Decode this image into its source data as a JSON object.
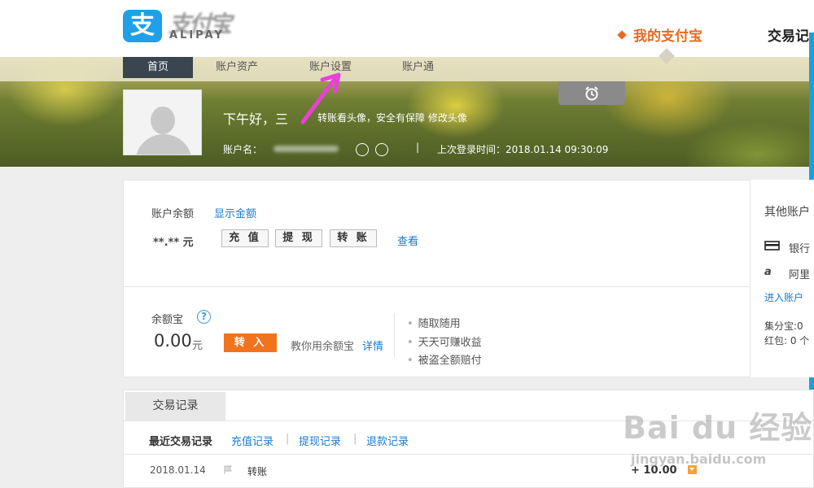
{
  "header": {
    "logo_glyph": "支",
    "logo_cn": "支付宝",
    "logo_en": "ALIPAY",
    "nav_mine": "我的支付宝",
    "nav_trade": "交易记"
  },
  "subnav": {
    "items": [
      "首页",
      "账户资产",
      "账户设置",
      "账户通"
    ],
    "active": "首页"
  },
  "profile": {
    "greeting": "下午好，三",
    "avatar_tip": "转账看头像，安全有保障 修改头像",
    "account_label": "账户名：",
    "last_login_label": "上次登录时间：",
    "last_login_value": "2018.01.14 09:30:09",
    "separator": "|"
  },
  "balance": {
    "label": "账户余额",
    "show_link": "显示金额",
    "amount_masked": "**.** 元",
    "buttons": [
      "充 值",
      "提 现",
      "转 账"
    ],
    "view_link": "查看"
  },
  "yuebao": {
    "title": "余额宝",
    "help": "?",
    "amount": "0.00",
    "unit": "元",
    "transfer_in": "转 入",
    "teach": "教你用余额宝",
    "detail_link": "详情",
    "features": [
      "随取随用",
      "天天可赚收益",
      "被盗全额赔付"
    ]
  },
  "side": {
    "title": "其他账户",
    "bank": "银行",
    "ali": "阿里",
    "enter": "进入账户",
    "jifen": "集分宝:0",
    "hongbao": "红包: 0 个"
  },
  "transactions": {
    "tab": "交易记录",
    "recent_label": "最近交易记录",
    "links": [
      "充值记录",
      "提现记录",
      "退款记录"
    ],
    "pipe": "|",
    "rows": [
      {
        "date": "2018.01.14",
        "type": "转账",
        "amount": "+ 10.00"
      }
    ]
  },
  "watermark": {
    "main": "Bai du 经验",
    "sub": "jingyan.baidu.com"
  },
  "colors": {
    "accent": "#e86a1e",
    "brand": "#1fa0e9",
    "link": "#1a7bd0",
    "orange_button": "#f2731d",
    "subnav_active": "#3b4550"
  }
}
